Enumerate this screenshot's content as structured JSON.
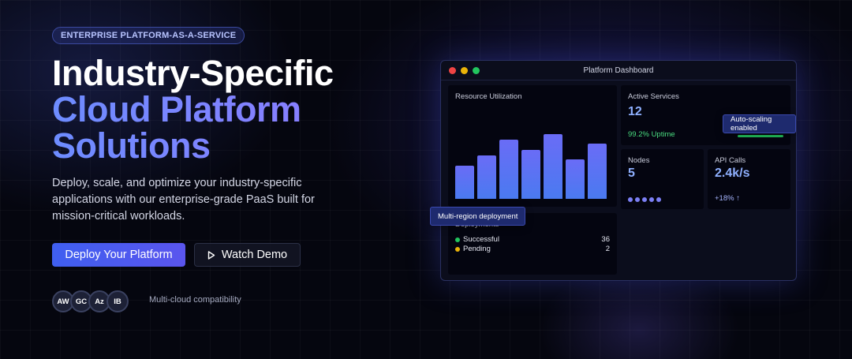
{
  "hero": {
    "badge": "ENTERPRISE PLATFORM-AS-A-SERVICE",
    "headline_line1": "Industry-Specific",
    "headline_line2": "Cloud Platform",
    "headline_line3": "Solutions",
    "subtitle": "Deploy, scale, and optimize your industry-specific applications with our enterprise-grade PaaS built for mission-critical workloads.",
    "primary_cta": "Deploy Your Platform",
    "secondary_cta": "Watch Demo",
    "providers": [
      "AW",
      "GC",
      "Az",
      "IB"
    ],
    "compat_text": "Multi-cloud compatibility"
  },
  "dashboard": {
    "title": "Platform Dashboard",
    "utilization": {
      "label": "Resource Utilization",
      "bar_levels": [
        0.42,
        0.55,
        0.75,
        0.62,
        0.82,
        0.5,
        0.7
      ]
    },
    "services": {
      "label": "Active Services",
      "value": "12",
      "uptime": "99.2% Uptime"
    },
    "nodes": {
      "label": "Nodes",
      "value": "5",
      "dot_count": 5
    },
    "api": {
      "label": "API Calls",
      "value": "2.4k/s",
      "growth": "+18% ↑"
    },
    "deployments": {
      "label": "Deployments",
      "rows": [
        {
          "label": "Successful",
          "count": "36",
          "color": "#22c55e"
        },
        {
          "label": "Pending",
          "count": "2",
          "color": "#eab308"
        }
      ]
    },
    "tooltips": {
      "autoscaling": "Auto-scaling enabled",
      "multiregion": "Multi-region deployment"
    }
  }
}
